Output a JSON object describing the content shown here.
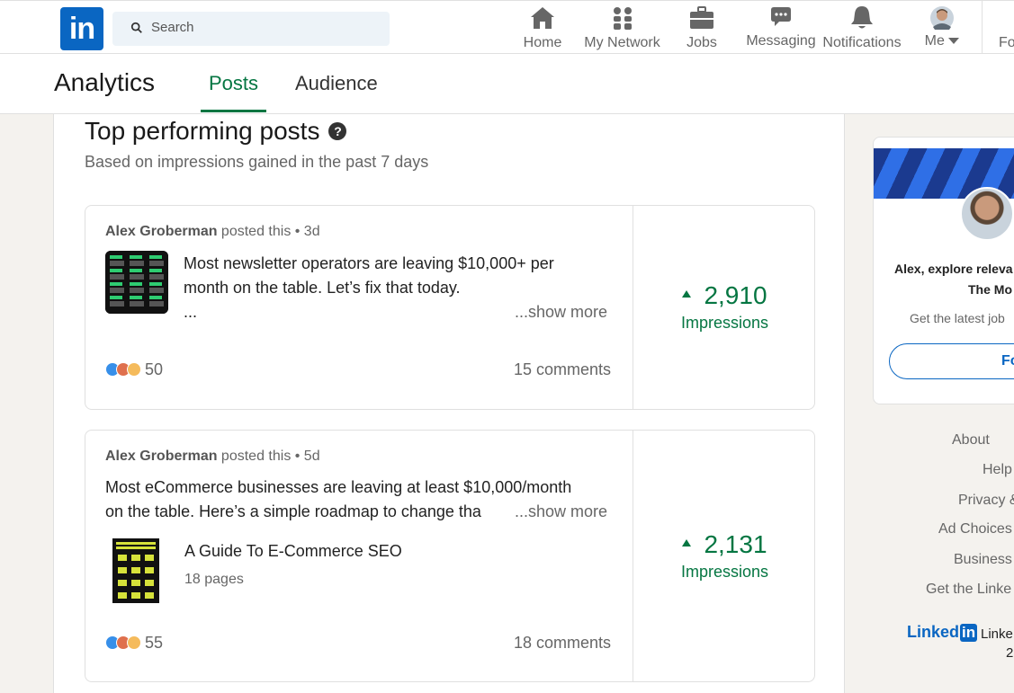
{
  "nav": {
    "search_placeholder": "Search",
    "items": [
      {
        "label": "Home",
        "icon": "home-icon"
      },
      {
        "label": "My Network",
        "icon": "people-icon"
      },
      {
        "label": "Jobs",
        "icon": "briefcase-icon"
      },
      {
        "label": "Messaging",
        "icon": "chat-icon"
      },
      {
        "label": "Notifications",
        "icon": "bell-icon"
      },
      {
        "label": "Me",
        "icon": "avatar-icon"
      }
    ],
    "partial_label": "Fo"
  },
  "subheader": {
    "title": "Analytics",
    "tabs": [
      {
        "label": "Posts",
        "active": true
      },
      {
        "label": "Audience",
        "active": false
      }
    ]
  },
  "section": {
    "title": "Top performing posts",
    "subtitle": "Based on impressions gained in the past 7 days"
  },
  "posts": [
    {
      "author": "Alex Groberman",
      "meta": " posted this • 3d",
      "text_line1": "Most newsletter operators are leaving $10,000+ per",
      "text_line2": "month on the table. Let’s fix that today.",
      "text_line3": "...",
      "show_more": "...show more",
      "reaction_count": "50",
      "comments": "15 comments",
      "impressions": "2,910",
      "impressions_label": "Impressions"
    },
    {
      "author": "Alex Groberman",
      "meta": " posted this • 5d",
      "text_line1": "Most eCommerce businesses are leaving at least $10,000/month",
      "text_line2": "on the table. Here’s a simple roadmap to change tha",
      "show_more": "...show more",
      "doc_title": "A Guide To E-Commerce SEO",
      "doc_pages": "18 pages",
      "reaction_count": "55",
      "comments": "18 comments",
      "impressions": "2,131",
      "impressions_label": "Impressions"
    }
  ],
  "ad": {
    "line1": "Alex, explore releva",
    "line2": "The Mo",
    "line3": "Get the latest job",
    "button": "Fo"
  },
  "footer": {
    "links": [
      "About",
      "Help",
      "Privacy &",
      "Ad Choices",
      "Business",
      "Get the Linke"
    ],
    "brand_a": "Linked",
    "brand_b": "in",
    "copy": "Linke",
    "copy2": "2"
  },
  "colors": {
    "brand": "#0a66c2",
    "positive": "#057642"
  }
}
